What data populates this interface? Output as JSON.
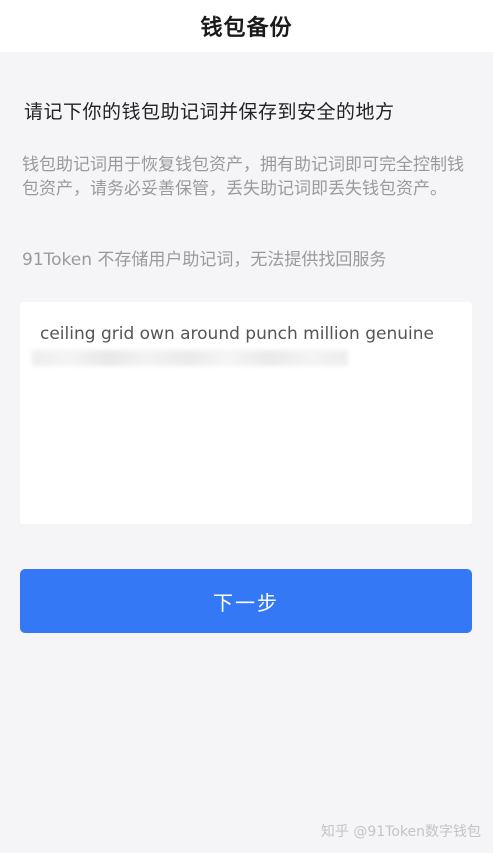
{
  "header": {
    "title": "钱包备份"
  },
  "main": {
    "heading": "请记下你的钱包助记词并保存到安全的地方",
    "description": "钱包助记词用于恢复钱包资产，拥有助记词即可完全控制钱包资产，请务必妥善保管，丢失助记词即丢失钱包资产。",
    "notice": "91Token 不存储用户助记词，无法提供找回服务",
    "mnemonic": {
      "visible_words": "ceiling grid own around punch million genuine"
    },
    "next_button_label": "下一步"
  },
  "watermark": "知乎 @91Token数字钱包",
  "colors": {
    "primary": "#3478f6",
    "background": "#f5f5f7"
  }
}
